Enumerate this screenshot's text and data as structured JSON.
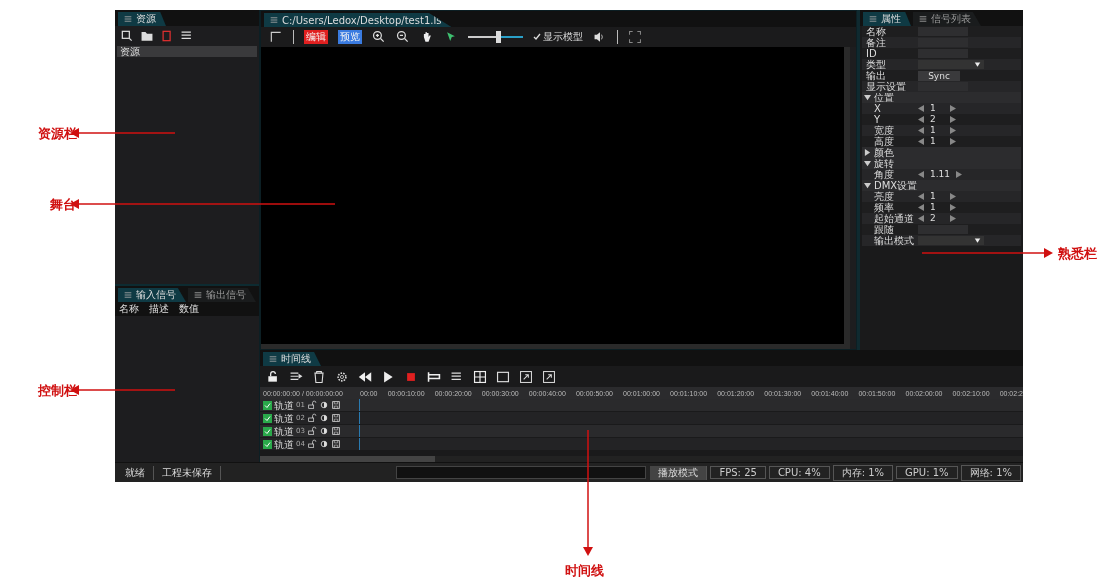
{
  "resource_panel": {
    "tab": "资源",
    "header": "资源"
  },
  "signal_panel": {
    "tabs": [
      {
        "label": "输入信号",
        "selected": true
      },
      {
        "label": "输出信号",
        "selected": false
      }
    ],
    "columns": [
      "名称",
      "描述",
      "数值"
    ]
  },
  "stage": {
    "tab": "C:/Users/Ledox/Desktop/test1.ls",
    "mode_buttons": [
      {
        "label": "编辑",
        "color": "#e02020"
      },
      {
        "label": "预览",
        "color": "#3a7be0"
      }
    ],
    "zoom": {
      "level": 0.55
    },
    "snap": {
      "label": "显示模型",
      "checked": true
    }
  },
  "properties": {
    "tabs": [
      {
        "label": "属性",
        "selected": true
      },
      {
        "label": "信号列表",
        "selected": false
      }
    ],
    "rows": [
      {
        "kind": "field",
        "label": "名称"
      },
      {
        "kind": "field",
        "label": "备注"
      },
      {
        "kind": "field",
        "label": "ID"
      },
      {
        "kind": "select",
        "label": "类型"
      },
      {
        "kind": "button",
        "label": "输出",
        "value": "Sync"
      },
      {
        "kind": "field",
        "label": "显示设置"
      },
      {
        "kind": "group",
        "label": "位置",
        "expanded": true
      },
      {
        "kind": "spin",
        "label": "X",
        "value": "1"
      },
      {
        "kind": "spin",
        "label": "Y",
        "value": "2"
      },
      {
        "kind": "spin",
        "label": "宽度",
        "value": "1"
      },
      {
        "kind": "spin",
        "label": "高度",
        "value": "1"
      },
      {
        "kind": "group",
        "label": "颜色",
        "expanded": false
      },
      {
        "kind": "group",
        "label": "旋转",
        "expanded": true
      },
      {
        "kind": "spin",
        "label": "角度",
        "value": "1.11"
      },
      {
        "kind": "group",
        "label": "DMX设置",
        "expanded": true
      },
      {
        "kind": "spin",
        "label": "亮度",
        "value": "1"
      },
      {
        "kind": "spin",
        "label": "频率",
        "value": "1"
      },
      {
        "kind": "spin",
        "label": "起始通道",
        "value": "2"
      },
      {
        "kind": "field",
        "label": "跟随"
      },
      {
        "kind": "select",
        "label": "输出模式"
      }
    ]
  },
  "timeline": {
    "tab": "时间线",
    "time": "00:00:00:00 / 00:00:00:00",
    "ticks": [
      "00:00",
      "00:00:10:00",
      "00:00:20:00",
      "00:00:30:00",
      "00:00:40:00",
      "00:00:50:00",
      "00:01:00:00",
      "00:01:10:00",
      "00:01:20:00",
      "00:01:30:00",
      "00:01:40:00",
      "00:01:50:00",
      "00:02:00:00",
      "00:02:10:00",
      "00:02:2"
    ],
    "tracks": [
      {
        "name": "轨道",
        "number": "01",
        "enabled": true
      },
      {
        "name": "轨道",
        "number": "02",
        "enabled": true
      },
      {
        "name": "轨道",
        "number": "03",
        "enabled": true
      },
      {
        "name": "轨道",
        "number": "04",
        "enabled": true
      }
    ]
  },
  "status_bar": {
    "left": [
      "就绪",
      "工程未保存"
    ],
    "mode": "播放模式",
    "cells": [
      "FPS: 25",
      "CPU: 4%",
      "内存: 1%",
      "GPU: 1%",
      "网络: 1%"
    ]
  },
  "callouts": [
    {
      "text": "资源栏"
    },
    {
      "text": "舞台"
    },
    {
      "text": "控制栏"
    },
    {
      "text": "熟悉栏"
    },
    {
      "text": "时间线"
    }
  ]
}
